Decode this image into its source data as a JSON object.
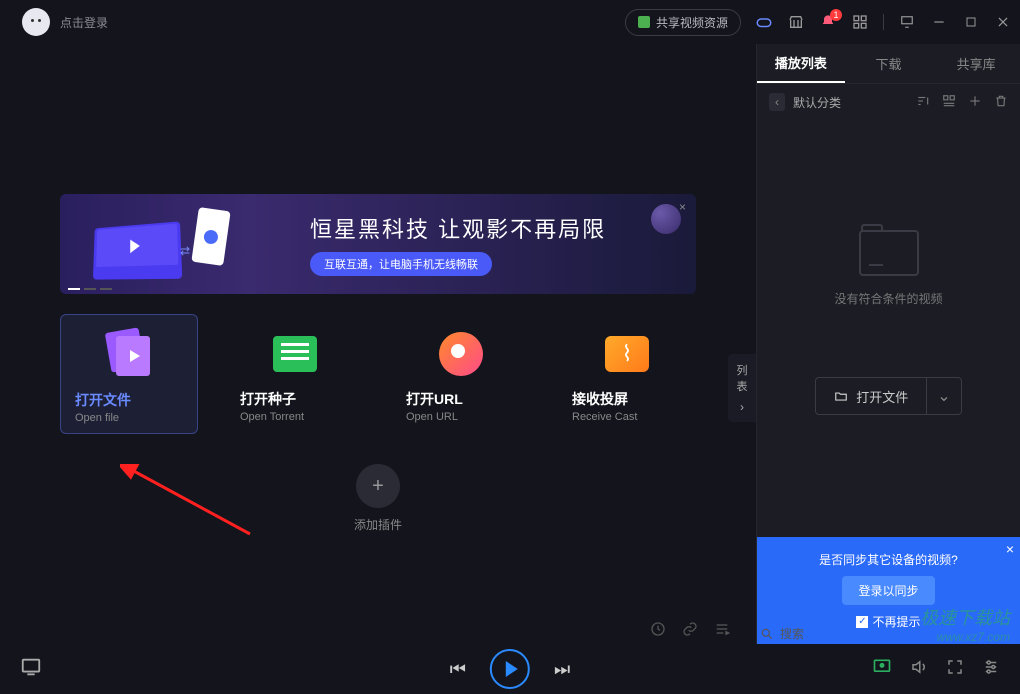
{
  "titlebar": {
    "login_text": "点击登录",
    "share_button": "共享视频资源",
    "notification_count": "1"
  },
  "banner": {
    "title": "恒星黑科技 让观影不再局限",
    "subtitle": "互联互通，让电脑手机无线畅联"
  },
  "cards": {
    "open_file": {
      "title": "打开文件",
      "sub": "Open file"
    },
    "open_torrent": {
      "title": "打开种子",
      "sub": "Open Torrent"
    },
    "open_url": {
      "title": "打开URL",
      "sub": "Open URL"
    },
    "receive_cast": {
      "title": "接收投屏",
      "sub": "Receive Cast"
    }
  },
  "list_toggle": "列表",
  "add_plugin": "添加插件",
  "sidebar": {
    "tabs": {
      "playlist": "播放列表",
      "download": "下载",
      "share": "共享库"
    },
    "category": "默认分类",
    "empty_text": "没有符合条件的视频",
    "open_file": "打开文件"
  },
  "sync": {
    "question": "是否同步其它设备的视频?",
    "login_btn": "登录以同步",
    "no_prompt": "不再提示"
  },
  "search_placeholder": "搜索",
  "watermark": {
    "name": "极速下载站",
    "url": "www.xz7.com"
  }
}
